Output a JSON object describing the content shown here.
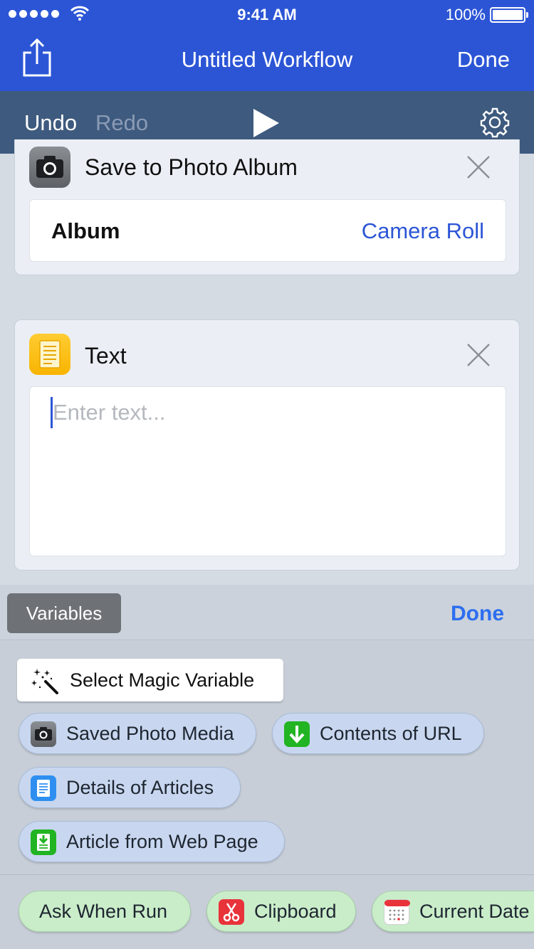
{
  "status": {
    "time": "9:41 AM",
    "battery": "100%"
  },
  "nav": {
    "title": "Untitled Workflow",
    "done": "Done"
  },
  "toolbar": {
    "undo": "Undo",
    "redo": "Redo"
  },
  "actions": [
    {
      "title": "Save to Photo Album",
      "param_label": "Album",
      "param_value": "Camera Roll"
    },
    {
      "title": "Text",
      "placeholder": "Enter text..."
    }
  ],
  "variables_bar": {
    "label": "Variables",
    "done": "Done"
  },
  "magic": {
    "label": "Select Magic Variable"
  },
  "variables": [
    {
      "label": "Saved Photo Media",
      "icon": "camera-icon"
    },
    {
      "label": "Contents of URL",
      "icon": "download-icon"
    },
    {
      "label": "Details of Articles",
      "icon": "article-icon"
    },
    {
      "label": "Article from Web Page",
      "icon": "web-article-icon"
    }
  ],
  "special_variables": [
    {
      "label": "Ask When Run"
    },
    {
      "label": "Clipboard",
      "icon": "scissors-icon"
    },
    {
      "label": "Current Date",
      "icon": "calendar-icon"
    }
  ],
  "colors": {
    "nav": "#2c55d6",
    "toolbar": "#3e5a7e",
    "accent": "#2c6ef0",
    "variable_pill": "#c8d7ef",
    "special_pill": "#c9edc9"
  }
}
